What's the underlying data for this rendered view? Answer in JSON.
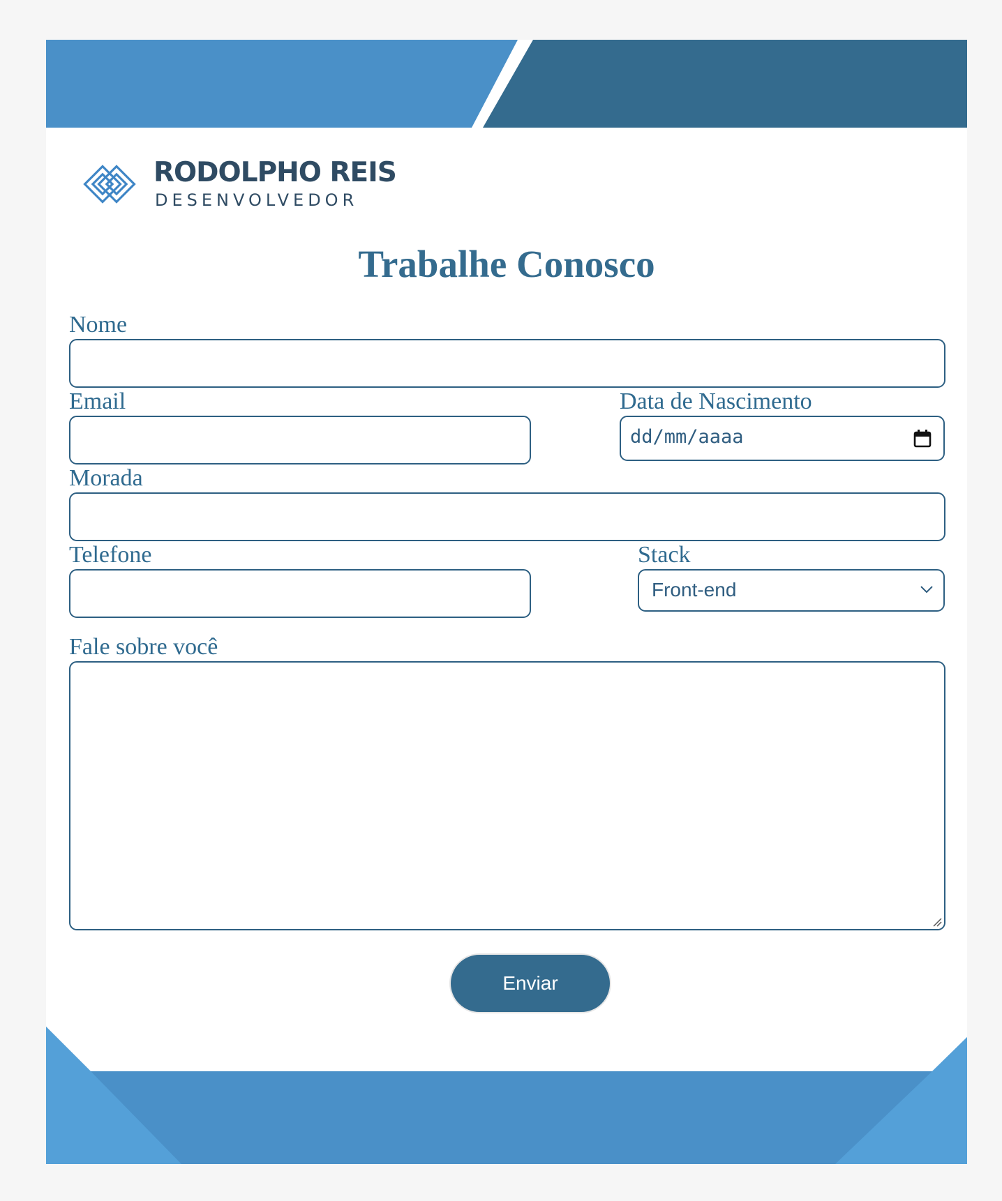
{
  "brand": {
    "name": "RODOLPHO REIS",
    "subtitle": "DESENVOLVEDOR",
    "logo_icon": "diamond-links-logo-icon",
    "colors": {
      "primary_dark": "#346b8e",
      "primary_blue": "#4a90c8",
      "light_blue": "#54a0d8",
      "text_dark": "#2f4b63"
    }
  },
  "page": {
    "title": "Trabalhe Conosco"
  },
  "form": {
    "nome": {
      "label": "Nome",
      "value": ""
    },
    "email": {
      "label": "Email",
      "value": ""
    },
    "data_nascimento": {
      "label": "Data de Nascimento",
      "placeholder": "dd/mm/aaaa",
      "icon": "calendar-icon"
    },
    "morada": {
      "label": "Morada",
      "value": ""
    },
    "telefone": {
      "label": "Telefone",
      "value": ""
    },
    "stack": {
      "label": "Stack",
      "selected": "Front-end",
      "icon": "chevron-down-icon"
    },
    "fale_sobre_voce": {
      "label": "Fale sobre você",
      "value": ""
    },
    "submit_label": "Enviar"
  }
}
